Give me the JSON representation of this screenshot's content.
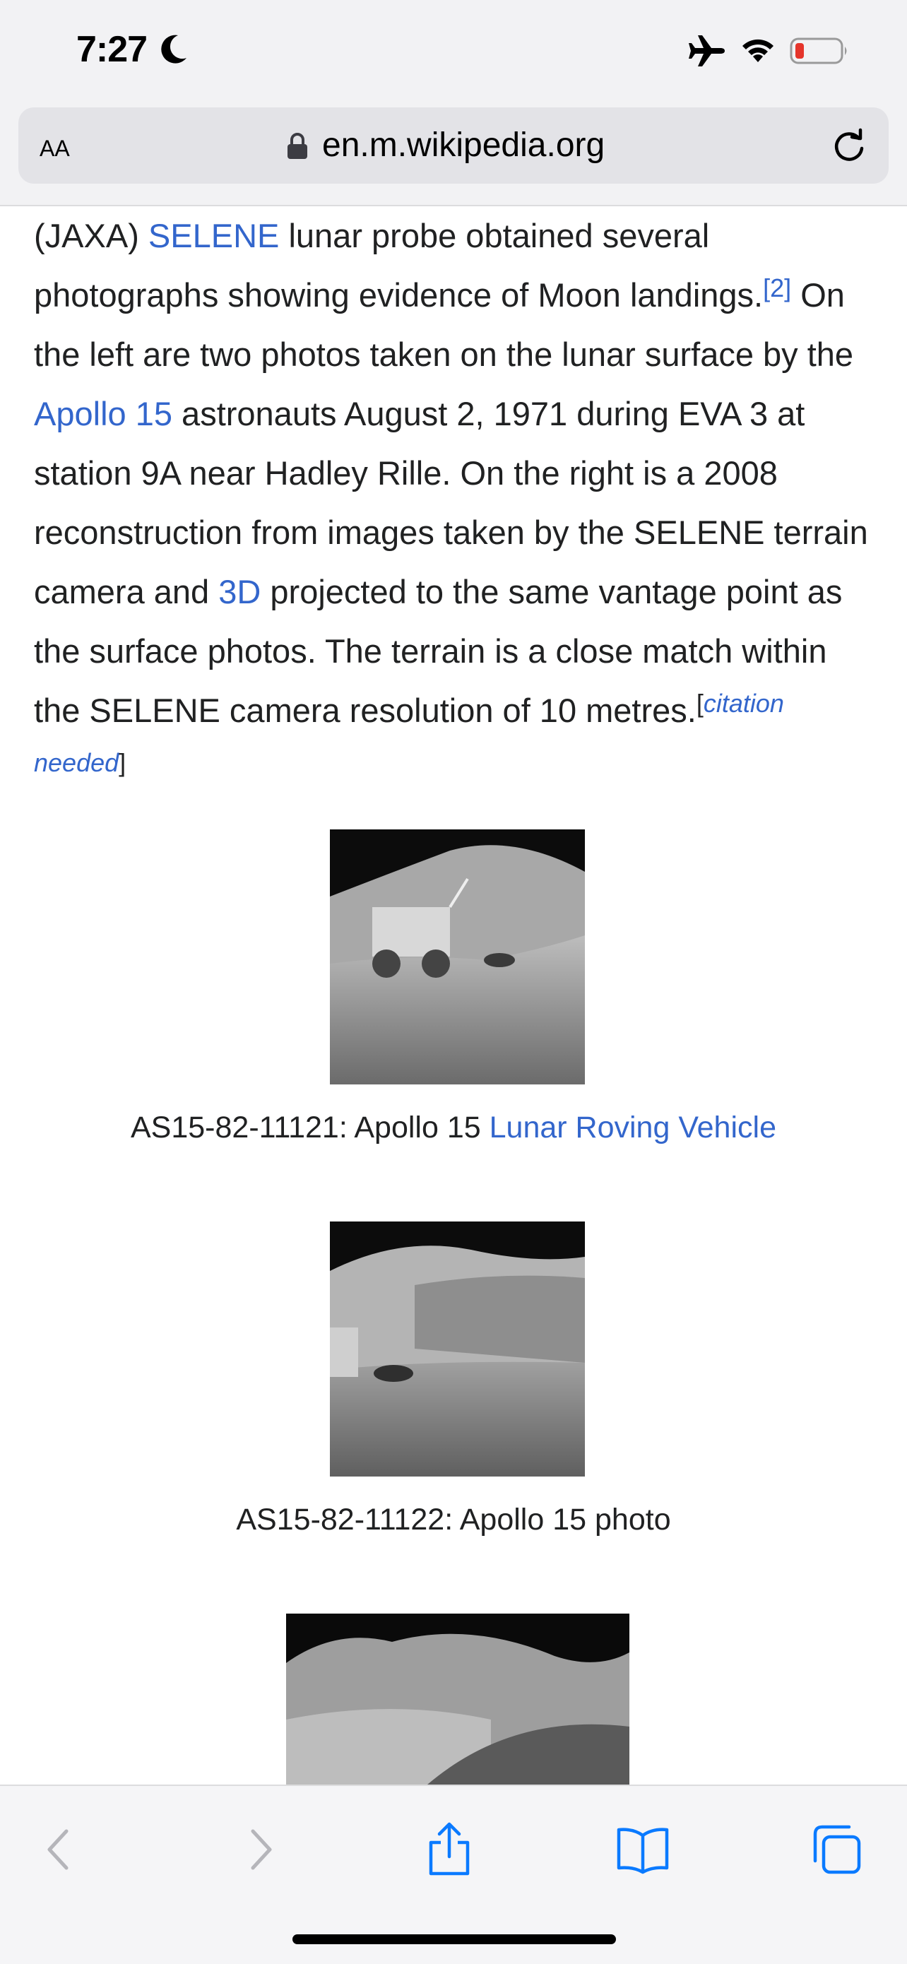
{
  "status_bar": {
    "time": "7:27",
    "icons": [
      "moon-icon",
      "airplane-icon",
      "wifi-icon",
      "battery-low-icon"
    ],
    "battery_color": "#e5352b"
  },
  "address_bar": {
    "text_size_label": "AA",
    "url": "en.m.wikipedia.org",
    "icons": [
      "lock-icon",
      "reload-icon"
    ]
  },
  "article": {
    "p1": "(JAXA) ",
    "link_selene": "SELENE",
    "p2": " lunar probe obtained several photographs showing evidence of Moon landings.",
    "ref2": "[2]",
    "p3": " On the left are two photos taken on the lunar surface by the ",
    "link_apollo15": "Apollo 15",
    "p4": " astronauts August 2, 1971 during EVA 3 at station 9A near Hadley Rille. On the right is a 2008 reconstruction from images taken by the SELENE terrain camera and ",
    "link_3d": "3D",
    "p5": " projected to the same vantage point as the surface photos. The terrain is a close match within the SELENE camera resolution of 10 metres.",
    "cite_open": "[",
    "cite_text": "citation needed",
    "cite_close": "]"
  },
  "gallery": [
    {
      "caption_text": "AS15-82-11121: Apollo 15 ",
      "caption_link": "Lunar Roving Vehicle"
    },
    {
      "caption_text": "AS15-82-11122: Apollo 15 photo",
      "caption_link": ""
    },
    {
      "caption_text": "",
      "caption_link": ""
    }
  ],
  "link_color": "#3366cc",
  "toolbar": {
    "icons": [
      "back-icon",
      "forward-icon",
      "share-icon",
      "bookmarks-icon",
      "tabs-icon"
    ],
    "accent": "#0a7aff"
  }
}
